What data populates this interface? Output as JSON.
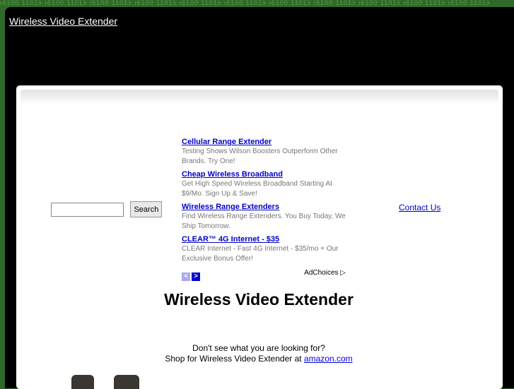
{
  "header": {
    "title": "Wireless Video Extender"
  },
  "search": {
    "placeholder": "",
    "button_label": "Search"
  },
  "ads": [
    {
      "title": "Cellular Range Extender",
      "text": "Testing Shows Wilson Boosters Outperform Other Brands. Try One!"
    },
    {
      "title": "Cheap Wireless Broadband",
      "text": "Get High Speed Wireless Broadband Starting At $9/Mo. Sign Up & Save!"
    },
    {
      "title": "Wireless Range Extenders",
      "text": "Find Wireless Range Extenders. You Buy Today, We Ship Tomorrow."
    },
    {
      "title": "CLEAR™ 4G Internet - $35",
      "text": "CLEAR Internet - Fast 4G Internet - $35/mo + Our Exclusive Bonus Offer!"
    }
  ],
  "adnav": {
    "prev_icon": "chevron-left-icon",
    "next_icon": "chevron-right-icon",
    "adchoices": "AdChoices ▷"
  },
  "contact": "Contact Us",
  "main": {
    "heading": "Wireless Video Extender",
    "prompt": "Don't see what you are looking for?",
    "shop_prefix": "Shop for Wireless Video Extender at ",
    "shop_link": "amazon.com"
  },
  "colors": {
    "background": "#2f6a2a",
    "link": "#0000cc"
  }
}
